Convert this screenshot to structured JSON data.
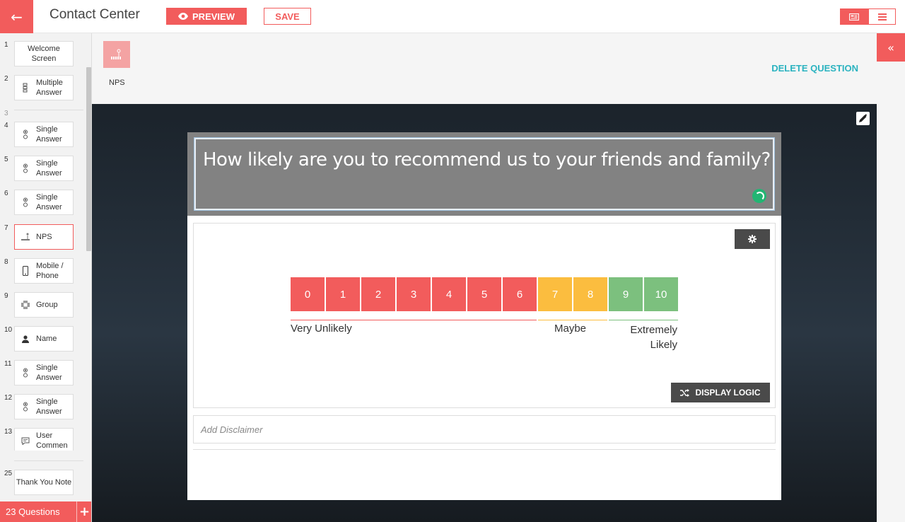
{
  "header": {
    "title": "Contact Center",
    "preview_label": "PREVIEW",
    "save_label": "SAVE"
  },
  "colors": {
    "accent": "#f25c5c",
    "teal": "#2bb3c0",
    "detractor": "#f25c5c",
    "passive": "#fbbd3f",
    "promoter": "#7cc07e"
  },
  "sidebar": {
    "items": [
      {
        "num": "1",
        "label": "Welcome Screen",
        "icon": "none"
      },
      {
        "num": "2",
        "label": "Multiple Answer",
        "icon": "checkbox-list-icon"
      },
      {
        "num": "3",
        "label": "",
        "icon": "none"
      },
      {
        "num": "4",
        "label": "Single Answer",
        "icon": "radio-list-icon"
      },
      {
        "num": "5",
        "label": "Single Answer",
        "icon": "radio-list-icon"
      },
      {
        "num": "6",
        "label": "Single Answer",
        "icon": "radio-list-icon"
      },
      {
        "num": "7",
        "label": "NPS",
        "icon": "nps-icon"
      },
      {
        "num": "8",
        "label": "Mobile / Phone",
        "icon": "mobile-icon"
      },
      {
        "num": "9",
        "label": "Group",
        "icon": "group-icon"
      },
      {
        "num": "10",
        "label": "Name",
        "icon": "user-icon"
      },
      {
        "num": "11",
        "label": "Single Answer",
        "icon": "radio-list-icon"
      },
      {
        "num": "12",
        "label": "Single Answer",
        "icon": "radio-list-icon"
      },
      {
        "num": "13",
        "label": "User Commen",
        "icon": "comment-icon"
      },
      {
        "num": "25",
        "label": "Thank You Note",
        "icon": "none"
      }
    ],
    "footer_count": "23 Questions",
    "footer_add": "+"
  },
  "question": {
    "type_label": "NPS",
    "delete_label": "DELETE QUESTION",
    "title": "How likely are you to recommend us to your friends and family?",
    "scale": [
      "0",
      "1",
      "2",
      "3",
      "4",
      "5",
      "6",
      "7",
      "8",
      "9",
      "10"
    ],
    "label_low": "Very Unlikely",
    "label_mid": "Maybe",
    "label_high": "Extremely Likely",
    "display_logic_label": "DISPLAY LOGIC",
    "disclaimer_placeholder": "Add Disclaimer"
  }
}
